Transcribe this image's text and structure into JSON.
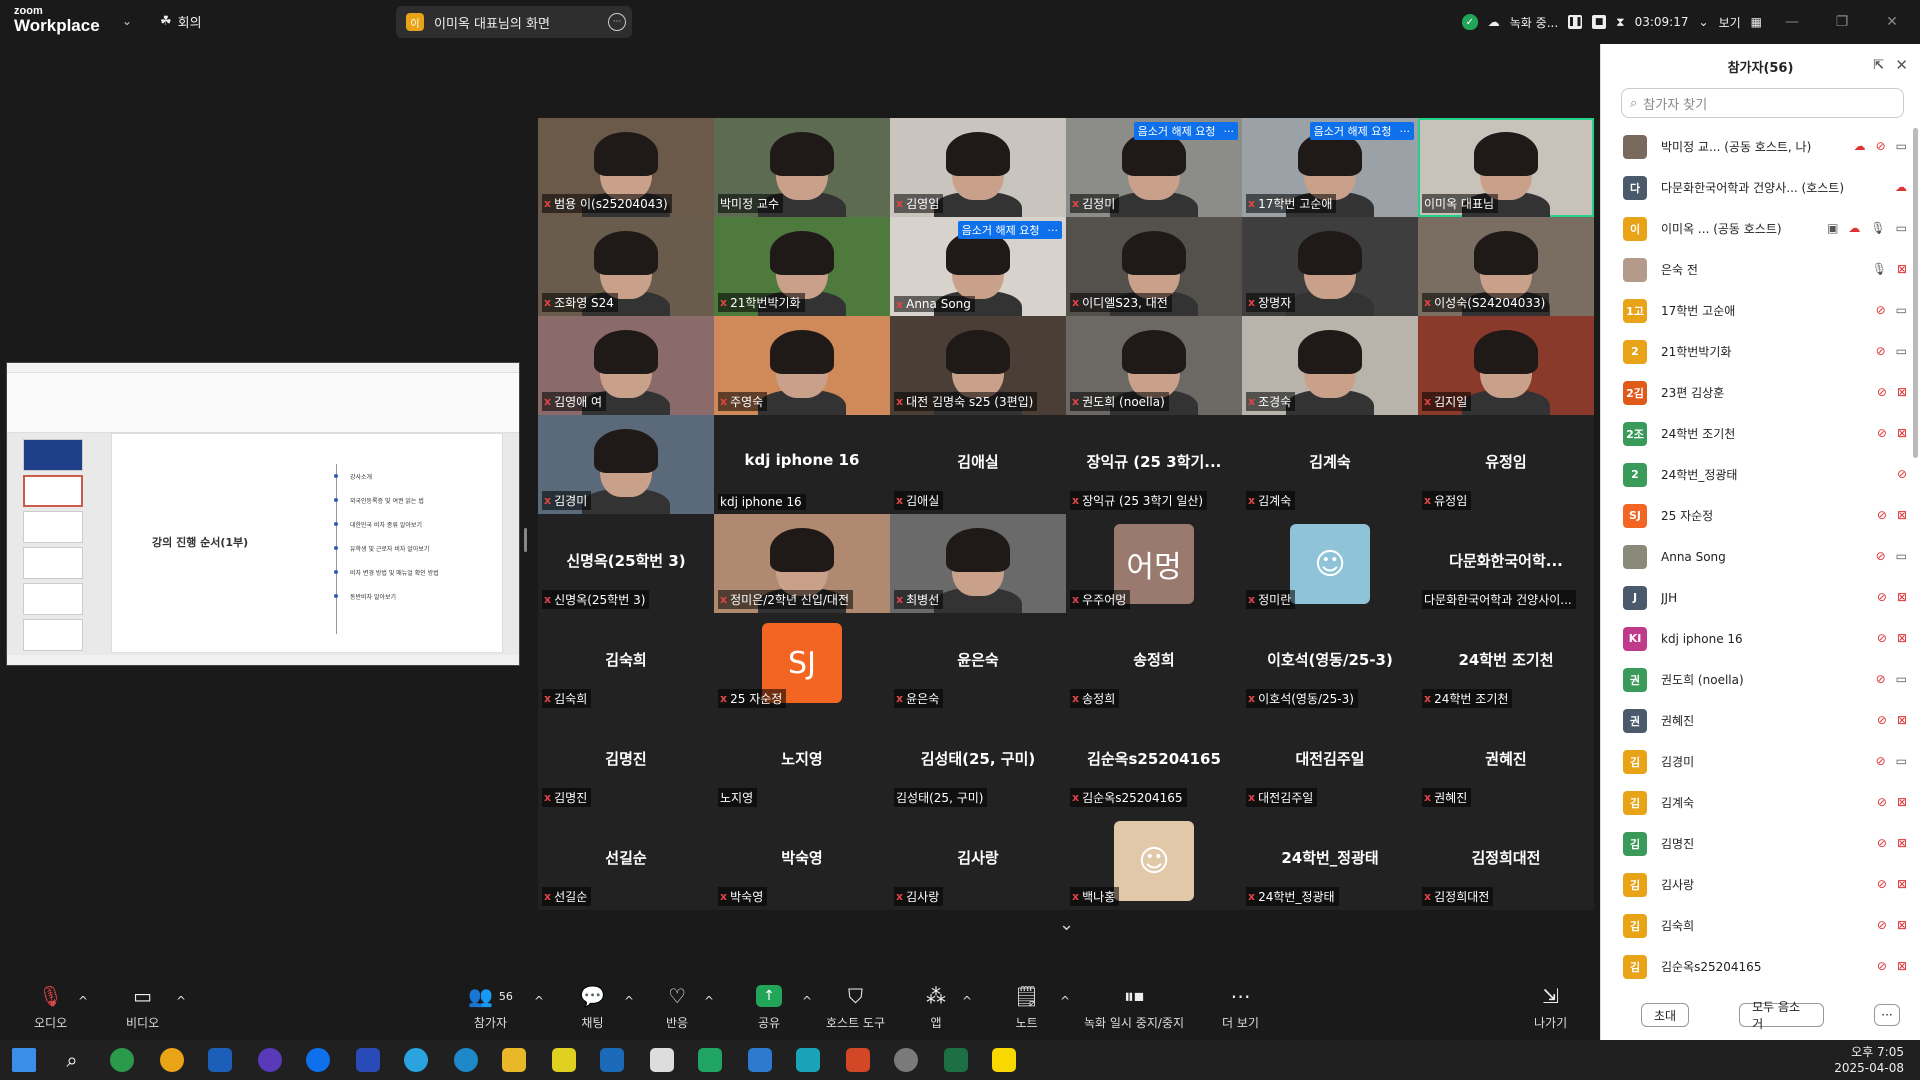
{
  "app": {
    "brand_top": "zoom",
    "brand_bottom": "Workplace"
  },
  "topbar": {
    "meeting_label": "회의",
    "share_badge": "이",
    "share_label": "이미옥 대표님의 화면",
    "recording_label": "녹화 중...",
    "timer": "03:09:17",
    "view_label": "보기"
  },
  "shared_screen": {
    "heading": "강의 진행 순서(1부)",
    "items": [
      "강사소개",
      "외국인등록증 및 여권 읽는 법",
      "대한민국 비자 종류 알아보기",
      "유학생 및 근로자 비자 알아보기",
      "비자 변경 방법 및 매뉴얼 확인 방법",
      "동반비자 알아보기"
    ]
  },
  "gallery": {
    "unmute_request_label": "음소거 해제 요청",
    "tiles": [
      {
        "big": "",
        "label": "범용 이(s25204043)",
        "muted": true,
        "photo": "#6b5a4a",
        "req": false
      },
      {
        "big": "",
        "label": "박미정 교수",
        "muted": false,
        "photo": "#5c6b52",
        "req": false
      },
      {
        "big": "",
        "label": "김영임",
        "muted": true,
        "photo": "#c9c4bd",
        "req": false
      },
      {
        "big": "",
        "label": "김정미",
        "muted": true,
        "photo": "#8c8c88",
        "req": true
      },
      {
        "big": "",
        "label": "17학번 고순애",
        "muted": true,
        "photo": "#9aa2a8",
        "req": true
      },
      {
        "big": "",
        "label": "이미옥 대표님",
        "muted": false,
        "photo": "#c8c2bb",
        "req": false,
        "active": true
      },
      {
        "big": "",
        "label": "조화영 S24",
        "muted": true,
        "photo": "#6a5c4c",
        "req": false
      },
      {
        "big": "",
        "label": "21학번박기화",
        "muted": true,
        "photo": "#4f7a3e",
        "req": false
      },
      {
        "big": "",
        "label": "Anna Song",
        "muted": true,
        "photo": "#d8d2cc",
        "req": true
      },
      {
        "big": "",
        "label": "이디엘S23, 대전",
        "muted": true,
        "photo": "#54504c",
        "req": false
      },
      {
        "big": "",
        "label": "장명자",
        "muted": true,
        "photo": "#3e3e3e",
        "req": false
      },
      {
        "big": "",
        "label": "이성숙(S24204033)",
        "muted": true,
        "photo": "#7a6e62",
        "req": false
      },
      {
        "big": "",
        "label": "김영애 여",
        "muted": true,
        "photo": "#8a6a6a",
        "req": false
      },
      {
        "big": "",
        "label": "주영숙",
        "muted": true,
        "photo": "#d08a5a",
        "req": false
      },
      {
        "big": "",
        "label": "대전 김명숙 s25 (3편입)",
        "muted": true,
        "photo": "#4a3e36",
        "req": false
      },
      {
        "big": "",
        "label": "권도희 (noella)",
        "muted": true,
        "photo": "#6c6864",
        "req": false
      },
      {
        "big": "",
        "label": "조경숙",
        "muted": true,
        "photo": "#b8b4ac",
        "req": false
      },
      {
        "big": "",
        "label": "김지일",
        "muted": true,
        "photo": "#8a3a2a",
        "req": false
      },
      {
        "big": "",
        "label": "김경미",
        "muted": true,
        "photo": "#5a6a7a",
        "req": false
      },
      {
        "big": "kdj iphone 16",
        "label": "kdj iphone 16",
        "muted": false,
        "photo": "",
        "req": false
      },
      {
        "big": "김애실",
        "label": "김애실",
        "muted": true,
        "photo": "",
        "req": false
      },
      {
        "big": "장익규 (25 3학기...",
        "label": "장익규 (25 3학기 일산)",
        "muted": true,
        "photo": "",
        "req": false
      },
      {
        "big": "김계숙",
        "label": "김계숙",
        "muted": true,
        "photo": "",
        "req": false
      },
      {
        "big": "유정임",
        "label": "유정임",
        "muted": true,
        "photo": "",
        "req": false
      },
      {
        "big": "신명옥(25학번 3)",
        "label": "신명옥(25학번 3)",
        "muted": true,
        "photo": "",
        "req": false
      },
      {
        "big": "",
        "label": "정미은/2학년 신입/대전",
        "muted": true,
        "photo": "#b08a70",
        "req": false
      },
      {
        "big": "",
        "label": "최병선",
        "muted": true,
        "photo": "#6a6a6a",
        "req": false
      },
      {
        "big": "",
        "label": "우주어멍",
        "muted": true,
        "photo": "",
        "avatar": "어멍",
        "avatar_color": "#9a7a6e",
        "req": false
      },
      {
        "big": "",
        "label": "정미란",
        "muted": true,
        "photo": "",
        "avatar": "☺",
        "avatar_color": "#8ec3d8",
        "req": false
      },
      {
        "big": "다문화한국어학...",
        "label": "다문화한국어학과 건양사이...",
        "muted": false,
        "photo": "",
        "req": false
      },
      {
        "big": "김숙희",
        "label": "김숙희",
        "muted": true,
        "photo": "",
        "req": false
      },
      {
        "big": "",
        "label": "25 자순정",
        "muted": true,
        "photo": "",
        "avatar": "SJ",
        "avatar_color": "#f26522",
        "req": false
      },
      {
        "big": "윤은숙",
        "label": "윤은숙",
        "muted": true,
        "photo": "",
        "req": false
      },
      {
        "big": "송정희",
        "label": "송정희",
        "muted": true,
        "photo": "",
        "req": false
      },
      {
        "big": "이호석(영동/25-3)",
        "label": "이호석(영동/25-3)",
        "muted": true,
        "photo": "",
        "req": false
      },
      {
        "big": "24학번 조기천",
        "label": "24학번 조기천",
        "muted": true,
        "photo": "",
        "req": false
      },
      {
        "big": "김명진",
        "label": "김명진",
        "muted": true,
        "photo": "",
        "req": false
      },
      {
        "big": "노지영",
        "label": "노지영",
        "muted": false,
        "photo": "",
        "req": false
      },
      {
        "big": "김성태(25, 구미)",
        "label": "김성태(25, 구미)",
        "muted": false,
        "photo": "",
        "req": false
      },
      {
        "big": "김순옥s25204165",
        "label": "김순옥s25204165",
        "muted": true,
        "photo": "",
        "req": false
      },
      {
        "big": "대전김주일",
        "label": "대전김주일",
        "muted": true,
        "photo": "",
        "req": false
      },
      {
        "big": "권혜진",
        "label": "권혜진",
        "muted": true,
        "photo": "",
        "req": false
      },
      {
        "big": "선길순",
        "label": "선길순",
        "muted": true,
        "photo": "",
        "req": false
      },
      {
        "big": "박숙영",
        "label": "박숙영",
        "muted": true,
        "photo": "",
        "req": false
      },
      {
        "big": "김사랑",
        "label": "김사랑",
        "muted": true,
        "photo": "",
        "req": false
      },
      {
        "big": "",
        "label": "백나홍",
        "muted": true,
        "photo": "",
        "avatar": "☺",
        "avatar_color": "#e0c8a8",
        "req": false
      },
      {
        "big": "24학번_정광태",
        "label": "24학번_정광태",
        "muted": true,
        "photo": "",
        "req": false
      },
      {
        "big": "김정희대전",
        "label": "김정희대전",
        "muted": true,
        "photo": "",
        "req": false
      }
    ]
  },
  "panel": {
    "title": "참가자(56)",
    "search_placeholder": "참가자 찾기",
    "participants": [
      {
        "av": "",
        "color": "#7a6a5e",
        "name": "박미정 교... (공동 호스트, 나)",
        "icons": [
          "cloud",
          "micoff",
          "vid"
        ]
      },
      {
        "av": "다",
        "color": "#4a5a6a",
        "name": "다문화한국어학과 건양사... (호스트)",
        "icons": [
          "cloud"
        ]
      },
      {
        "av": "이",
        "color": "#e8a317",
        "name": "이미옥 ... (공동 호스트)",
        "icons": [
          "share",
          "cloud",
          "mic",
          "vid"
        ]
      },
      {
        "av": "",
        "color": "#b49a8a",
        "name": "은숙 전",
        "icons": [
          "mic",
          "vidoff"
        ]
      },
      {
        "av": "1고",
        "color": "#e8a317",
        "name": "17학번 고순애",
        "icons": [
          "micoff",
          "vid"
        ]
      },
      {
        "av": "2",
        "color": "#e8a317",
        "name": "21학번박기화",
        "icons": [
          "micoff",
          "vid"
        ]
      },
      {
        "av": "2김",
        "color": "#e05a1a",
        "name": "23편 김상훈",
        "icons": [
          "micoff",
          "vidoff"
        ]
      },
      {
        "av": "2조",
        "color": "#3a9a5a",
        "name": "24학번 조기천",
        "icons": [
          "micoff",
          "vidoff"
        ]
      },
      {
        "av": "2",
        "color": "#3a9a5a",
        "name": "24학번_정광태",
        "icons": [
          "micoff"
        ]
      },
      {
        "av": "SJ",
        "color": "#f26522",
        "name": "25 자순정",
        "icons": [
          "micoff",
          "vidoff"
        ]
      },
      {
        "av": "",
        "color": "#8a8a7a",
        "name": "Anna Song",
        "icons": [
          "micoff",
          "vid"
        ]
      },
      {
        "av": "J",
        "color": "#4a5a6a",
        "name": "JJH",
        "icons": [
          "micoff",
          "vidoff"
        ]
      },
      {
        "av": "KI",
        "color": "#c03a8a",
        "name": "kdj iphone 16",
        "icons": [
          "micoff",
          "vidoff"
        ]
      },
      {
        "av": "권",
        "color": "#3a9a5a",
        "name": "권도희 (noella)",
        "icons": [
          "micoff",
          "vid"
        ]
      },
      {
        "av": "권",
        "color": "#4a5a6a",
        "name": "권혜진",
        "icons": [
          "micoff",
          "vidoff"
        ]
      },
      {
        "av": "김",
        "color": "#e8a317",
        "name": "김경미",
        "icons": [
          "micoff",
          "vid"
        ]
      },
      {
        "av": "김",
        "color": "#e8a317",
        "name": "김계숙",
        "icons": [
          "micoff",
          "vidoff"
        ]
      },
      {
        "av": "김",
        "color": "#3a9a5a",
        "name": "김명진",
        "icons": [
          "micoff",
          "vidoff"
        ]
      },
      {
        "av": "김",
        "color": "#e8a317",
        "name": "김사랑",
        "icons": [
          "micoff",
          "vidoff"
        ]
      },
      {
        "av": "김",
        "color": "#e8a317",
        "name": "김숙희",
        "icons": [
          "micoff",
          "vidoff"
        ]
      },
      {
        "av": "김",
        "color": "#e8a317",
        "name": "김순옥s25204165",
        "icons": [
          "micoff",
          "vidoff"
        ]
      }
    ],
    "invite_label": "초대",
    "mute_all_label": "모두 음소거",
    "more_label": "···"
  },
  "toolbar": {
    "audio": "오디오",
    "video": "비디오",
    "participants": "참가자",
    "participants_count": "56",
    "chat": "채팅",
    "reactions": "반응",
    "share": "공유",
    "host_tools": "호스트 도구",
    "apps": "앱",
    "notes": "노트",
    "recording": "녹화 일시 중지/중지",
    "more": "더 보기",
    "leave": "나가기"
  },
  "taskbar": {
    "time": "오후 7:05",
    "date": "2025-04-08"
  }
}
